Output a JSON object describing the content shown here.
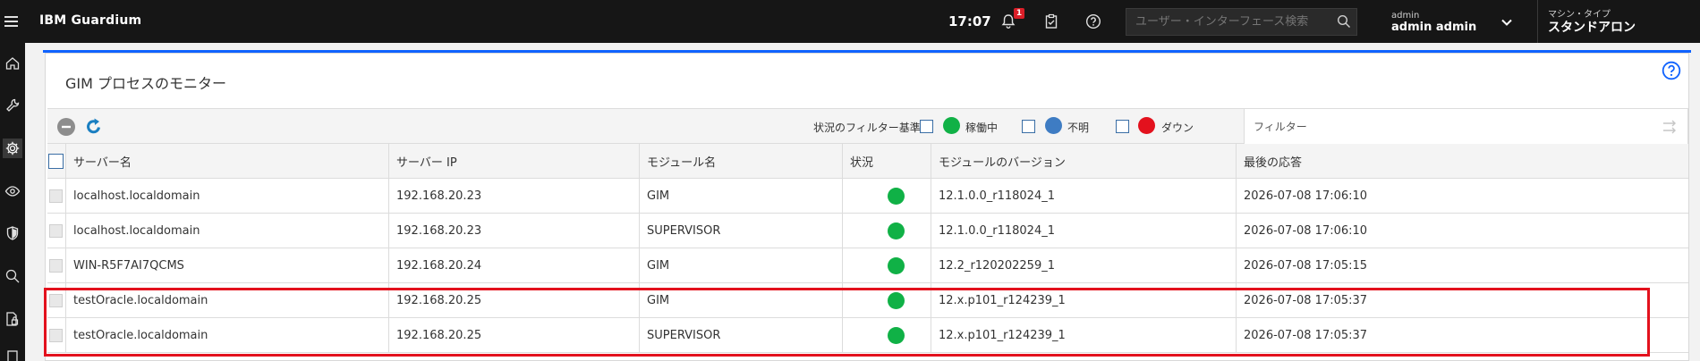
{
  "header": {
    "brand": "IBM Guardium",
    "time": "17:07",
    "notification_count": "1",
    "search_placeholder": "ユーザー・インターフェース検索",
    "user_role": "admin",
    "user_name": "admin admin",
    "machine_type_label": "マシン・タイプ",
    "machine_type_value": "スタンドアロン"
  },
  "panel": {
    "title": "GIM プロセスのモニター"
  },
  "toolbar": {
    "filter_label": "状況のフィルター基準",
    "statuses": [
      {
        "label": "稼働中",
        "color": "#10b146"
      },
      {
        "label": "不明",
        "color": "#3e7cc3"
      },
      {
        "label": "ダウン",
        "color": "#e3111d"
      }
    ],
    "filter_placeholder": "フィルター"
  },
  "table": {
    "columns": [
      "サーバー名",
      "サーバー IP",
      "モジュール名",
      "状況",
      "モジュールのバージョン",
      "最後の応答"
    ],
    "rows": [
      {
        "server": "localhost.localdomain",
        "ip": "192.168.20.23",
        "module": "GIM",
        "status": "running",
        "version": "12.1.0.0_r118024_1",
        "last": "2026-07-08 17:06:10"
      },
      {
        "server": "localhost.localdomain",
        "ip": "192.168.20.23",
        "module": "SUPERVISOR",
        "status": "running",
        "version": "12.1.0.0_r118024_1",
        "last": "2026-07-08 17:06:10"
      },
      {
        "server": "WIN-R5F7AI7QCMS",
        "ip": "192.168.20.24",
        "module": "GIM",
        "status": "running",
        "version": "12.2_r120202259_1",
        "last": "2026-07-08 17:05:15"
      },
      {
        "server": "testOracle.localdomain",
        "ip": "192.168.20.25",
        "module": "GIM",
        "status": "running",
        "version": "12.x.p101_r124239_1",
        "last": "2026-07-08 17:05:37"
      },
      {
        "server": "testOracle.localdomain",
        "ip": "192.168.20.25",
        "module": "SUPERVISOR",
        "status": "running",
        "version": "12.x.p101_r124239_1",
        "last": "2026-07-08 17:05:37"
      }
    ]
  },
  "colors": {
    "running": "#10b146",
    "accent": "#0f62fe",
    "highlight": "#e3111d"
  }
}
